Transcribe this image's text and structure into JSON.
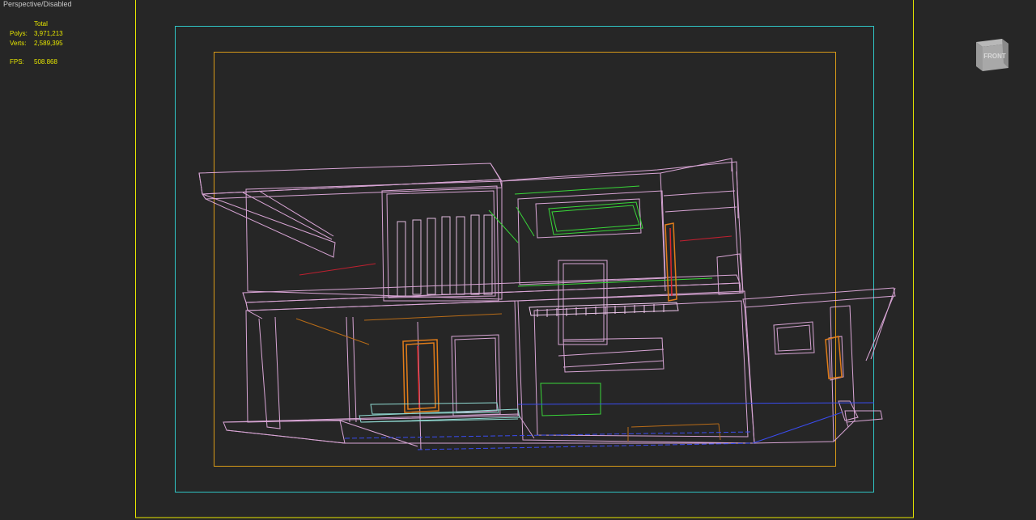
{
  "viewport": {
    "label": "Perspective/Disabled",
    "stats": {
      "header": "Total",
      "polys_label": "Polys:",
      "polys_value": "3,971,213",
      "verts_label": "Verts:",
      "verts_value": "2,589,395",
      "fps_label": "FPS:",
      "fps_value": "508.868"
    },
    "view_cube": {
      "face_label": "FRONT",
      "icon": "view-cube-icon"
    }
  },
  "colors": {
    "background": "#262626",
    "safe_frame_outer": "#e6e600",
    "safe_frame_action": "#2fc4c4",
    "safe_frame_title": "#d89a18",
    "wire_main": "#e8b0e4",
    "wire_green": "#39d639",
    "wire_orange": "#e07c1a",
    "wire_red": "#e0262a",
    "wire_blue": "#3a4cf0",
    "stats_text": "#e6e600"
  }
}
